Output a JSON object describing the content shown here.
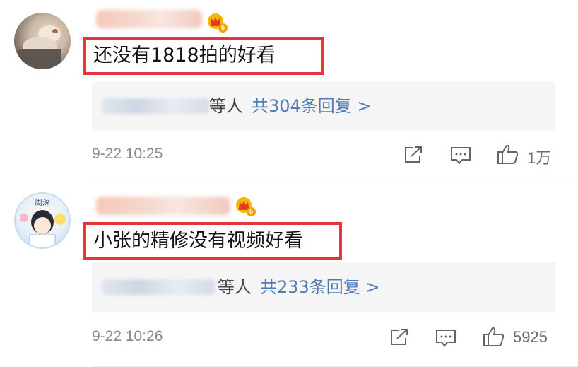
{
  "comments": [
    {
      "level": "5",
      "text": "还没有1818拍的好看",
      "reply_suffix": "等人",
      "reply_count": "共304条回复 >",
      "time": "9-22 10:25",
      "likes": "1万"
    },
    {
      "level": "6",
      "avatar_label": "周深",
      "text": "小张的精修没有视频好看",
      "reply_suffix": "等人",
      "reply_count": "共233条回复 >",
      "time": "9-22 10:26",
      "likes": "5925"
    }
  ],
  "icons": {
    "share": "share-icon",
    "comment": "comment-icon",
    "like": "thumbs-up-icon",
    "badge": "crown-icon"
  },
  "colors": {
    "highlight_border": "#e8333a",
    "link_blue": "#4f7bb8",
    "badge_gold": "#f2a200"
  }
}
